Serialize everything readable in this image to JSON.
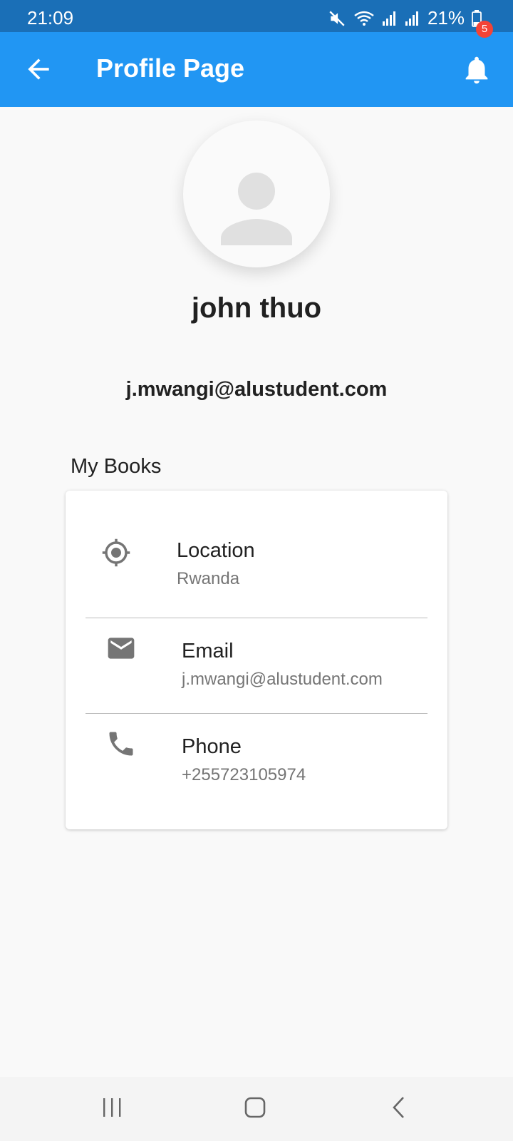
{
  "status_bar": {
    "time": "21:09",
    "battery": "21%",
    "icons": [
      "mute-icon",
      "wifi-icon",
      "signal-icon",
      "signal-icon",
      "battery-icon"
    ]
  },
  "app_bar": {
    "title": "Profile Page",
    "back_icon": "arrow-back-icon",
    "notification_icon": "bell-icon",
    "notification_count": "5",
    "background_color": "#2196f3"
  },
  "profile": {
    "avatar_icon": "person-icon",
    "name": "john thuo",
    "email": "j.mwangi@alustudent.com"
  },
  "section": {
    "title": "My Books"
  },
  "details": [
    {
      "icon": "location-target-icon",
      "label": "Location",
      "value": "Rwanda"
    },
    {
      "icon": "email-icon",
      "label": "Email",
      "value": "j.mwangi@alustudent.com"
    },
    {
      "icon": "phone-icon",
      "label": "Phone",
      "value": "+255723105974"
    }
  ],
  "nav_bar": {
    "buttons": [
      "recent-apps-icon",
      "home-icon",
      "back-icon"
    ]
  }
}
